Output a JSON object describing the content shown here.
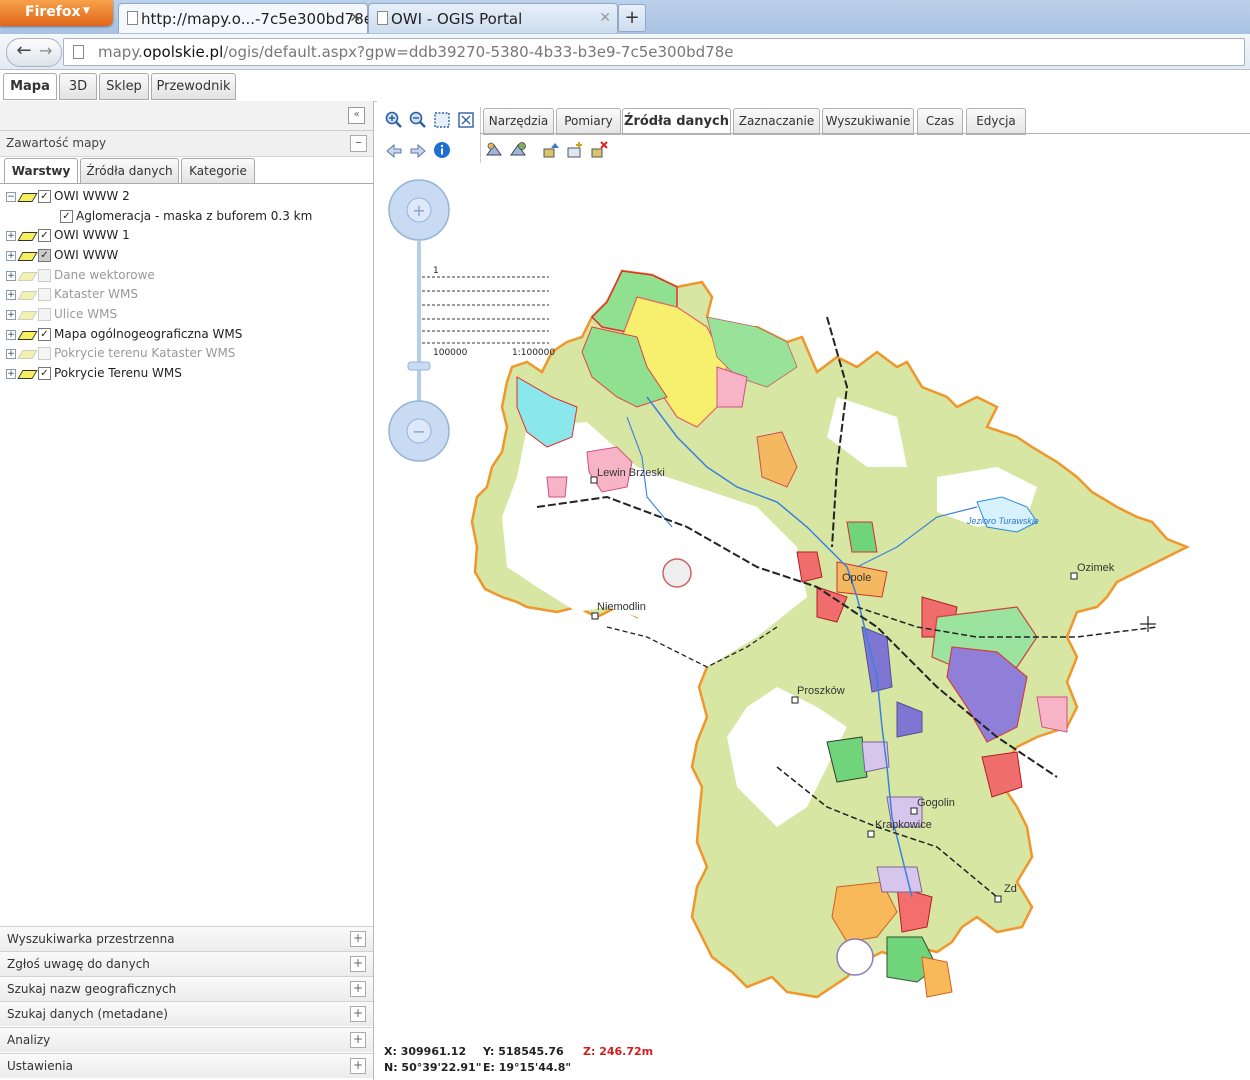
{
  "browser": {
    "firefox_button": "Firefox",
    "tabs": [
      {
        "title": "http://mapy.o...-7c5e300bd78e",
        "active": true
      },
      {
        "title": "OWI - OGIS Portal",
        "active": false
      }
    ],
    "url_prefix": "mapy.",
    "url_domain": "opolskie.pl",
    "url_rest": "/ogis/default.aspx?gpw=ddb39270-5380-4b33-b3e9-7c5e300bd78e"
  },
  "app_tabs": [
    "Mapa",
    "3D",
    "Sklep",
    "Przewodnik"
  ],
  "left": {
    "section_title": "Zawartość mapy",
    "tabs": [
      "Warstwy",
      "Źródła danych",
      "Kategorie"
    ],
    "layers": [
      {
        "label": "OWI WWW 2",
        "checked": true,
        "enabled": true,
        "expanded": true
      },
      {
        "label": "Aglomeracja - maska z buforem 0.3 km",
        "checked": true,
        "enabled": true,
        "child": true
      },
      {
        "label": "OWI WWW 1",
        "checked": true,
        "enabled": true
      },
      {
        "label": "OWI WWW",
        "checked": true,
        "enabled": true
      },
      {
        "label": "Dane wektorowe",
        "checked": false,
        "enabled": false
      },
      {
        "label": "Kataster WMS",
        "checked": false,
        "enabled": false
      },
      {
        "label": "Ulice WMS",
        "checked": false,
        "enabled": false
      },
      {
        "label": "Mapa ogólnogeograficzna WMS",
        "checked": true,
        "enabled": true
      },
      {
        "label": "Pokrycie terenu Kataster WMS",
        "checked": false,
        "enabled": false
      },
      {
        "label": "Pokrycie Terenu WMS",
        "checked": true,
        "enabled": true
      }
    ],
    "accordion": [
      "Wyszukiwarka przestrzenna",
      "Zgłoś uwagę do danych",
      "Szukaj nazw geograficznych",
      "Szukaj danych (metadane)",
      "Analizy",
      "Ustawienia"
    ]
  },
  "map": {
    "tabs": [
      "Narzędzia",
      "Pomiary",
      "Źródła danych",
      "Zaznaczanie",
      "Wyszukiwanie",
      "Czas",
      "Edycja"
    ],
    "active_tab": "Źródła danych",
    "scale_top": "1",
    "scale_left": "100000",
    "scale_right": "1:100000",
    "places": {
      "lewin": "Lewin Brzeski",
      "niemodlin": "Niemodlin",
      "opole": "Opole",
      "ozimek": "Ozimek",
      "jezioro": "Jezioro Turawskie",
      "proszkow": "Proszków",
      "gogolin": "Gogolin",
      "krapkowice": "Krapkowice",
      "zd": "Zd"
    }
  },
  "coords": {
    "x": "X: 309961.12",
    "y": "Y: 518545.76",
    "z": "Z: 246.72m",
    "n": "N: 50°39'22.91\"",
    "e": "E: 19°15'44.8\""
  },
  "colors": {
    "boundary": "#f0962a",
    "terrain_green": "#d9e7a6",
    "zoom_blue": "#c9dbf2",
    "z_red": "#d51d1d"
  }
}
